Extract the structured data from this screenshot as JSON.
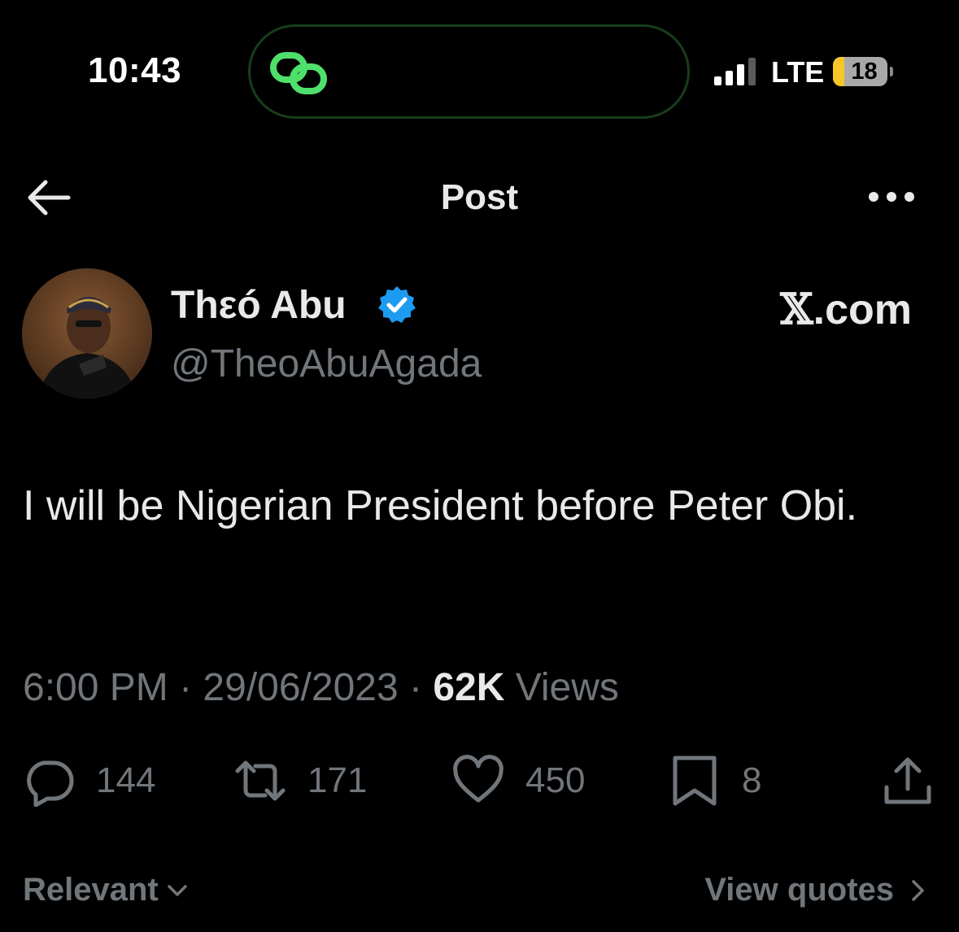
{
  "status_bar": {
    "time": "10:43",
    "network": "LTE",
    "battery_level": "18",
    "icons": [
      "link-icon",
      "signal-icon",
      "battery-icon"
    ]
  },
  "header": {
    "title": "Post",
    "icons": [
      "back-arrow-icon",
      "more-options-icon"
    ]
  },
  "author": {
    "display_name": "Thεó Abu",
    "handle": "@TheoAbuAgada",
    "verified_icon": "verified-badge-icon",
    "source_mark": "𝕏",
    "source_domain": ".com"
  },
  "post": {
    "text": "I will be Nigerian President before Peter Obi.",
    "time": "6:00 PM",
    "separator": " · ",
    "date": "29/06/2023",
    "views_count": "62K",
    "views_label": " Views"
  },
  "actions": {
    "replies": "144",
    "reposts": "171",
    "likes": "450",
    "bookmarks": "8",
    "icons": [
      "reply-icon",
      "repost-icon",
      "like-icon",
      "bookmark-icon",
      "share-icon"
    ]
  },
  "footer": {
    "sort_label": "Relevant",
    "view_quotes_label": "View quotes"
  },
  "colors": {
    "background": "#000000",
    "text_primary": "#e7e9ea",
    "text_secondary": "#71767b",
    "verified_blue": "#1d9bf0",
    "island_accent": "#4ee06b",
    "battery_low": "#f7c72a"
  }
}
